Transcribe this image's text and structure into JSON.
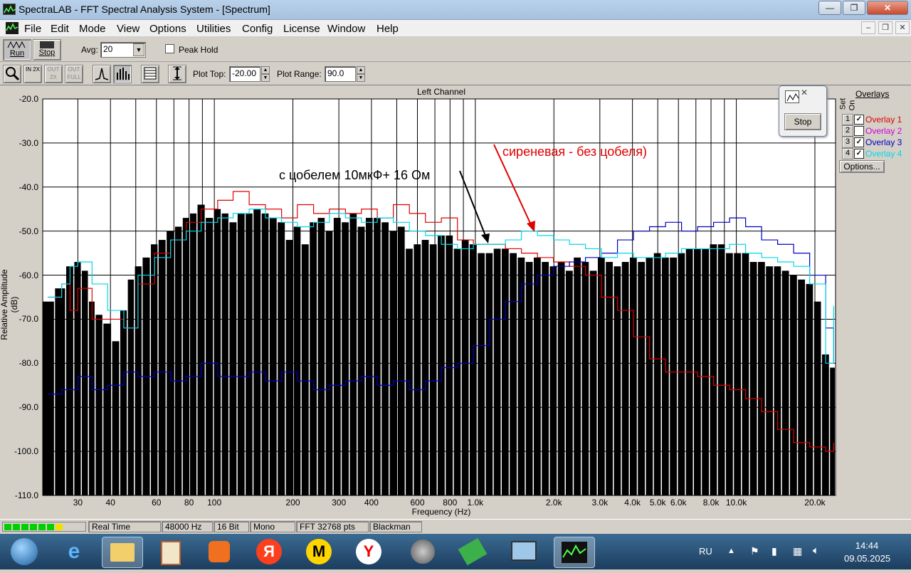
{
  "window": {
    "title": "SpectraLAB - FFT Spectral Analysis System - [Spectrum]",
    "min": "—",
    "max": "❐",
    "close": "✕"
  },
  "menu": [
    "File",
    "Edit",
    "Mode",
    "View",
    "Options",
    "Utilities",
    "Config",
    "License",
    "Window",
    "Help"
  ],
  "mdi": {
    "min": "–",
    "restore": "❐",
    "close": "✕"
  },
  "toolbar1": {
    "run_label": "Run",
    "stop_label": "Stop",
    "avg_label": "Avg:",
    "avg_value": "20",
    "peak_hold_label": "Peak Hold",
    "peak_hold_checked": false
  },
  "toolbar2": {
    "zoom_buttons": [
      "IN 2X",
      "OUT 2X",
      "OUT FULL"
    ],
    "plot_top_label": "Plot Top:",
    "plot_top_value": "-20.00",
    "plot_range_label": "Plot Range:",
    "plot_range_value": "90.0"
  },
  "overlays": {
    "title": "Overlays",
    "col_set": "Set",
    "col_on": "On",
    "items": [
      {
        "num": "1",
        "label": "Overlay 1",
        "on": true,
        "color": "#e00000"
      },
      {
        "num": "2",
        "label": "Overlay 2",
        "on": false,
        "color": "#d000d0"
      },
      {
        "num": "3",
        "label": "Overlay 3",
        "on": true,
        "color": "#0000c0"
      },
      {
        "num": "4",
        "label": "Overlay 4",
        "on": true,
        "color": "#00d8e8"
      }
    ],
    "options_label": "Options..."
  },
  "float_window": {
    "stop_label": "Stop"
  },
  "annotations": {
    "red_text": "сиреневая - без цобеля)",
    "black_text": "с цобелем 10мкФ+ 16 Ом"
  },
  "status": {
    "mode": "Real Time",
    "rate": "48000 Hz",
    "bits": "16 Bit",
    "channels": "Mono",
    "fft": "FFT 32768 pts",
    "window": "Blackman"
  },
  "taskbar": {
    "lang": "RU",
    "time": "14:44",
    "date": "09.05.2025",
    "apps": [
      "start-orb",
      "internet-explorer-icon",
      "folder-icon",
      "archive-icon",
      "media-player-icon",
      "yandex-icon",
      "music-icon",
      "yandex-browser-icon",
      "speaker-icon",
      "money-icon",
      "computer-icon",
      "spectralab-icon"
    ]
  },
  "chart_data": {
    "type": "bar",
    "title": "Left Channel",
    "xlabel": "Frequency (Hz)",
    "ylabel": "Relative Amplitude (dB)",
    "x_scale": "log",
    "xlim": [
      22,
      24000
    ],
    "ylim": [
      -110,
      -20
    ],
    "grid": true,
    "ytick_labels": [
      "-20.0",
      "-30.0",
      "-40.0",
      "-50.0",
      "-60.0",
      "-70.0",
      "-80.0",
      "-90.0",
      "-100.0",
      "-110.0"
    ],
    "xtick_labels": [
      "30",
      "40",
      "60",
      "80",
      "100",
      "200",
      "300",
      "400",
      "600",
      "800",
      "1.0k",
      "2.0k",
      "3.0k",
      "4.0k",
      "5.0k",
      "6.0k",
      "8.0k",
      "10.0k",
      "20.0k"
    ],
    "xtick_values": [
      30,
      40,
      60,
      80,
      100,
      200,
      300,
      400,
      600,
      800,
      1000,
      2000,
      3000,
      4000,
      5000,
      6000,
      8000,
      10000,
      20000
    ],
    "bars": {
      "name": "Spectrum",
      "x": [
        23,
        26,
        28,
        30,
        32,
        34,
        36,
        39,
        42,
        45,
        48,
        51,
        55,
        59,
        63,
        68,
        73,
        78,
        83,
        89,
        96,
        103,
        110,
        118,
        127,
        136,
        146,
        157,
        168,
        181,
        194,
        208,
        223,
        240,
        257,
        276,
        296,
        318,
        341,
        366,
        393,
        421,
        452,
        485,
        521,
        559,
        600,
        644,
        691,
        741,
        796,
        854,
        916,
        983,
        1055,
        1132,
        1215,
        1304,
        1399,
        1502,
        1612,
        1730,
        1856,
        1992,
        2138,
        2294,
        2462,
        2642,
        2836,
        3043,
        3266,
        3505,
        3762,
        4037,
        4333,
        4650,
        4990,
        5356,
        5747,
        6168,
        6620,
        7104,
        7624,
        8182,
        8781,
        9424,
        10114,
        10854,
        11648,
        12500,
        13415,
        14397,
        15451,
        16582,
        17795,
        19097,
        20495,
        21995,
        23605
      ],
      "values": [
        -66,
        -63,
        -58,
        -57,
        -59,
        -66,
        -69,
        -71,
        -75,
        -68,
        -61,
        -58,
        -56,
        -53,
        -52,
        -50,
        -49,
        -47,
        -46,
        -44,
        -47,
        -45,
        -46,
        -48,
        -46,
        -46,
        -45,
        -46,
        -47,
        -48,
        -52,
        -49,
        -53,
        -48,
        -47,
        -50,
        -47,
        -48,
        -46,
        -49,
        -47,
        -47,
        -48,
        -50,
        -49,
        -54,
        -53,
        -52,
        -53,
        -51,
        -51,
        -54,
        -52,
        -53,
        -55,
        -55,
        -54,
        -54,
        -55,
        -56,
        -57,
        -56,
        -57,
        -58,
        -57,
        -59,
        -56,
        -57,
        -59,
        -56,
        -57,
        -58,
        -57,
        -56,
        -57,
        -56,
        -55,
        -56,
        -56,
        -55,
        -54,
        -54,
        -54,
        -53,
        -53,
        -55,
        -55,
        -55,
        -57,
        -57,
        -58,
        -58,
        -59,
        -60,
        -61,
        -62,
        -66,
        -78,
        -81,
        -84
      ]
    },
    "series": [
      {
        "name": "Overlay 1",
        "color": "#e00000",
        "x": [
          23,
          26,
          28,
          30,
          34,
          39,
          45,
          51,
          59,
          68,
          78,
          89,
          103,
          118,
          136,
          157,
          181,
          208,
          240,
          276,
          318,
          366,
          421,
          485,
          559,
          644,
          741,
          854,
          983,
          1132,
          1304,
          1502,
          1730,
          1992,
          2294,
          2642,
          3043,
          3505,
          4037,
          4650,
          5356,
          6168,
          7104,
          8182,
          9424,
          10854,
          12500,
          14397,
          16582,
          19097,
          21995,
          23605
        ],
        "y": [
          -65,
          -62,
          -68,
          -63,
          -70,
          -70,
          -72,
          -62,
          -55,
          -52,
          -48,
          -45,
          -43,
          -41,
          -44,
          -45,
          -47,
          -44,
          -46,
          -45,
          -46,
          -45,
          -47,
          -44,
          -46,
          -48,
          -47,
          -52,
          -53,
          -53,
          -54,
          -55,
          -56,
          -57,
          -58,
          -60,
          -65,
          -68,
          -74,
          -79,
          -82,
          -82,
          -83,
          -85,
          -86,
          -88,
          -91,
          -95,
          -98,
          -99,
          -100,
          -98
        ]
      },
      {
        "name": "Overlay 3",
        "color": "#0000c0",
        "x": [
          23,
          26,
          30,
          34,
          39,
          45,
          51,
          59,
          68,
          78,
          89,
          103,
          118,
          136,
          157,
          181,
          208,
          240,
          276,
          318,
          366,
          421,
          485,
          559,
          644,
          741,
          854,
          983,
          1132,
          1304,
          1502,
          1730,
          1992,
          2294,
          2642,
          3043,
          3505,
          4037,
          4650,
          5356,
          6168,
          7104,
          8182,
          9424,
          10854,
          12500,
          14397,
          16582,
          19097,
          21995,
          23605
        ],
        "y": [
          -87,
          -86,
          -83,
          -86,
          -85,
          -82,
          -83,
          -82,
          -84,
          -83,
          -80,
          -83,
          -83,
          -82,
          -84,
          -82,
          -84,
          -86,
          -85,
          -84,
          -83,
          -85,
          -84,
          -86,
          -84,
          -81,
          -80,
          -76,
          -70,
          -66,
          -62,
          -60,
          -58,
          -57,
          -56,
          -55,
          -52,
          -50,
          -49,
          -48,
          -50,
          -49,
          -48,
          -47,
          -49,
          -52,
          -53,
          -55,
          -60,
          -72,
          -80
        ]
      },
      {
        "name": "Overlay 4",
        "color": "#00d8e8",
        "x": [
          23,
          26,
          28,
          30,
          34,
          39,
          45,
          51,
          59,
          68,
          78,
          89,
          103,
          118,
          136,
          157,
          181,
          208,
          240,
          276,
          318,
          366,
          421,
          485,
          559,
          644,
          741,
          854,
          983,
          1132,
          1304,
          1502,
          1730,
          1992,
          2294,
          2642,
          3043,
          3505,
          4037,
          4650,
          5356,
          6168,
          7104,
          8182,
          9424,
          10854,
          12500,
          14397,
          16582,
          19097,
          21995,
          23605
        ],
        "y": [
          -65,
          -62,
          -58,
          -57,
          -62,
          -68,
          -72,
          -60,
          -56,
          -52,
          -50,
          -48,
          -47,
          -46,
          -45,
          -47,
          -48,
          -49,
          -48,
          -46,
          -47,
          -48,
          -47,
          -48,
          -50,
          -51,
          -53,
          -54,
          -53,
          -53,
          -52,
          -50,
          -51,
          -52,
          -53,
          -54,
          -56,
          -55,
          -56,
          -56,
          -55,
          -54,
          -54,
          -54,
          -53,
          -55,
          -56,
          -57,
          -58,
          -62,
          -80,
          -67
        ]
      }
    ]
  }
}
